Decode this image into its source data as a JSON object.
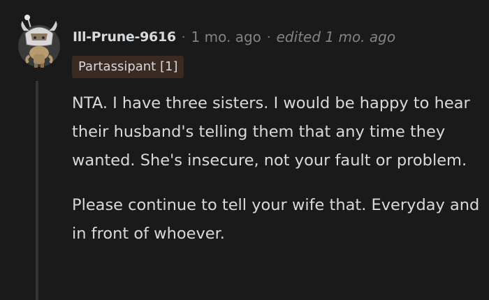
{
  "comment": {
    "username": "Ill-Prune-9616",
    "separator": "·",
    "time": "1 mo. ago",
    "edited": "edited 1 mo. ago",
    "flair": "Partassipant [1]",
    "paragraphs": [
      "NTA. I have three sisters. I would be happy to hear their husband's telling them that any time they wanted. She's insecure, not your fault or problem.",
      "Please continue to tell your wife that. Everyday and in front of whoever."
    ]
  },
  "avatar": {
    "icon": "snoo-avatar-icon",
    "colors": {
      "background": "#3a3a3c",
      "helmet": "#d8d8d8",
      "tan": "#b89a6e"
    }
  },
  "colors": {
    "page_background": "#1a1a1b",
    "text": "#d7dadc",
    "meta": "#818384",
    "flair_background": "#3a2a22",
    "thread_line": "#343536"
  }
}
